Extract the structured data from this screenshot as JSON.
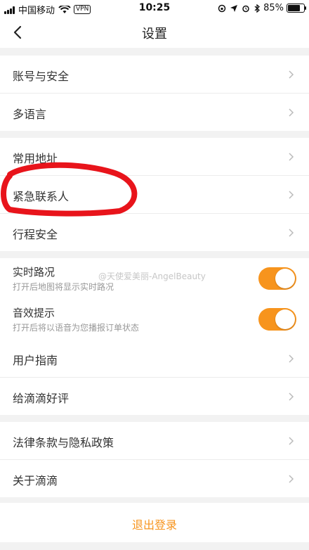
{
  "status_bar": {
    "carrier": "中国移动",
    "vpn": "VPN",
    "time": "10:25",
    "battery": "85%",
    "battery_level": 0.85
  },
  "header": {
    "title": "设置"
  },
  "groups": [
    {
      "items": [
        {
          "label": "账号与安全"
        },
        {
          "label": "多语言"
        }
      ]
    },
    {
      "items": [
        {
          "label": "常用地址"
        },
        {
          "label": "紧急联系人"
        },
        {
          "label": "行程安全"
        }
      ]
    },
    {
      "toggles": [
        {
          "label": "实时路况",
          "sub": "打开后地图将显示实时路况",
          "on": true
        },
        {
          "label": "音效提示",
          "sub": "打开后将以语音为您播报订单状态",
          "on": true
        }
      ]
    },
    {
      "items": [
        {
          "label": "用户指南"
        },
        {
          "label": "给滴滴好评"
        }
      ]
    },
    {
      "items": [
        {
          "label": "法律条款与隐私政策"
        },
        {
          "label": "关于滴滴"
        }
      ]
    }
  ],
  "logout": {
    "label": "退出登录"
  },
  "watermark": "@天使爱美丽-AngelBeauty",
  "colors": {
    "accent": "#f7941d",
    "annotation": "#e8141b"
  }
}
